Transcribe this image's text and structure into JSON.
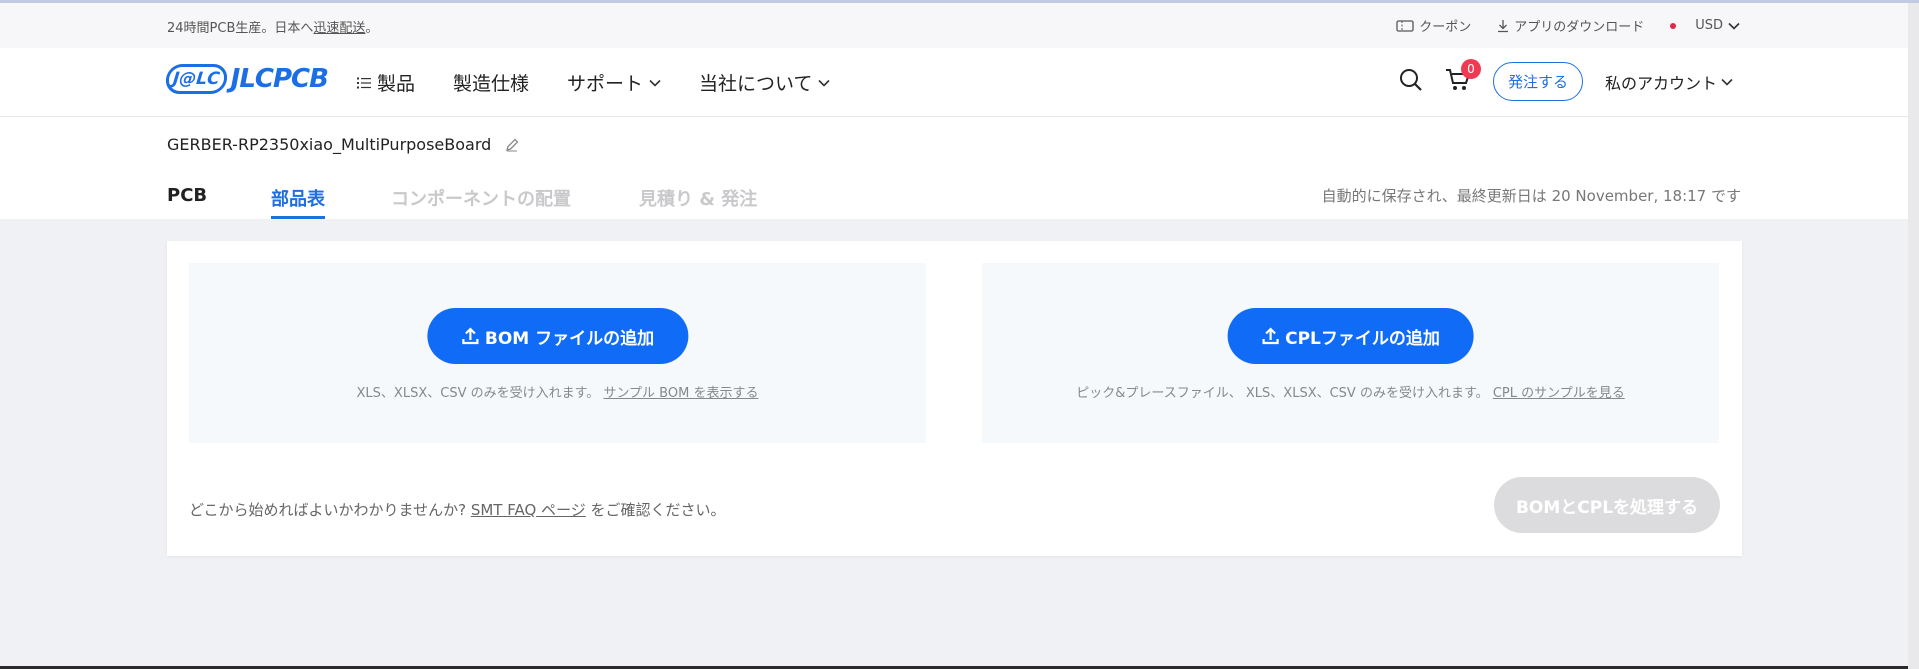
{
  "topbar": {
    "promo_prefix": "24時間PCB生産。日本へ",
    "promo_link": "迅速配送",
    "promo_suffix": "。",
    "coupon": "クーポン",
    "download": "アプリのダウンロード",
    "currency": "USD"
  },
  "nav": {
    "logo_mark": "J@LC",
    "logo_word": "JLCPCB",
    "menu": [
      "製品",
      "製造仕様",
      "サポート",
      "当社について"
    ],
    "cart_count": "0",
    "order_button": "発注する",
    "account": "私のアカウント"
  },
  "project": {
    "filename": "GERBER-RP2350xiao_MultiPurposeBoard"
  },
  "tabs": [
    "PCB",
    "部品表",
    "コンポーネントの配置",
    "見積り & 発注"
  ],
  "saved_status": "自動的に保存され、最終更新日は 20 November, 18:17 です",
  "bom": {
    "button": "BOM ファイルの追加",
    "hint": "XLS、XLSX、CSV のみを受け入れます。",
    "link": "サンプル BOM を表示する"
  },
  "cpl": {
    "button": "CPLファイルの追加",
    "hint": "ピック&プレースファイル、 XLS、XLSX、CSV のみを受け入れます。",
    "link": "CPL のサンプルを見る"
  },
  "faq": {
    "prefix": "どこから始めればよいかわかりませんか? ",
    "link": "SMT FAQ ページ",
    "suffix": " をご確認ください。"
  },
  "process_button": "BOMとCPLを処理する",
  "colors": {
    "primary": "#106cf6",
    "accent_blue": "#1f6fe0",
    "badge": "#f03a52",
    "disabled": "#dcdcde"
  }
}
